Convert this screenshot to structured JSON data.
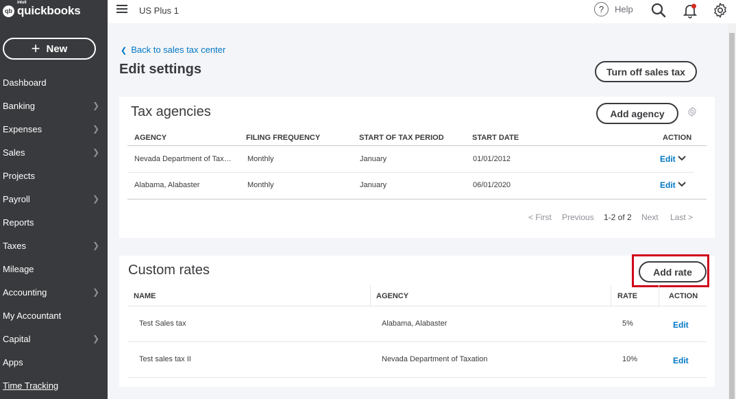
{
  "app": {
    "logo_intuit": "intuit",
    "logo_text": "quickbooks",
    "logo_mark": "qb"
  },
  "sidebar": {
    "new_label": "New",
    "items": [
      {
        "label": "Dashboard",
        "has_chevron": false
      },
      {
        "label": "Banking",
        "has_chevron": true
      },
      {
        "label": "Expenses",
        "has_chevron": true
      },
      {
        "label": "Sales",
        "has_chevron": true
      },
      {
        "label": "Projects",
        "has_chevron": false
      },
      {
        "label": "Payroll",
        "has_chevron": true
      },
      {
        "label": "Reports",
        "has_chevron": false
      },
      {
        "label": "Taxes",
        "has_chevron": true
      },
      {
        "label": "Mileage",
        "has_chevron": false
      },
      {
        "label": "Accounting",
        "has_chevron": true
      },
      {
        "label": "My Accountant",
        "has_chevron": false
      },
      {
        "label": "Capital",
        "has_chevron": true
      },
      {
        "label": "Apps",
        "has_chevron": false
      },
      {
        "label": "Time Tracking",
        "has_chevron": false
      }
    ]
  },
  "topbar": {
    "company": "US Plus 1",
    "help_label": "Help",
    "help_glyph": "?"
  },
  "page": {
    "back_link": "Back to sales tax center",
    "title": "Edit settings",
    "turn_off_label": "Turn off sales tax"
  },
  "agencies": {
    "title": "Tax agencies",
    "add_label": "Add agency",
    "headers": {
      "agency": "AGENCY",
      "frequency": "FILING FREQUENCY",
      "start_period": "START OF TAX PERIOD",
      "start_date": "START DATE",
      "action": "ACTION"
    },
    "rows": [
      {
        "agency": "Nevada Department of Tax…",
        "frequency": "Monthly",
        "start_period": "January",
        "start_date": "01/01/2012",
        "action": "Edit"
      },
      {
        "agency": "Alabama, Alabaster",
        "frequency": "Monthly",
        "start_period": "January",
        "start_date": "06/01/2020",
        "action": "Edit"
      }
    ],
    "pager": {
      "first": "< First",
      "previous": "Previous",
      "range": "1-2 of 2",
      "next": "Next",
      "last": "Last >"
    }
  },
  "rates": {
    "title": "Custom rates",
    "add_label": "Add rate",
    "headers": {
      "name": "NAME",
      "agency": "AGENCY",
      "rate": "RATE",
      "action": "ACTION"
    },
    "rows": [
      {
        "name": "Test Sales tax",
        "agency": "Alabama, Alabaster",
        "rate": "5%",
        "action": "Edit"
      },
      {
        "name": "Test sales tax II",
        "agency": "Nevada Department of Taxation",
        "rate": "10%",
        "action": "Edit"
      }
    ]
  },
  "colors": {
    "sidebar": "#393a3d",
    "link": "#0077c5",
    "highlight": "#d0021b",
    "notification": "#d52b1e"
  }
}
